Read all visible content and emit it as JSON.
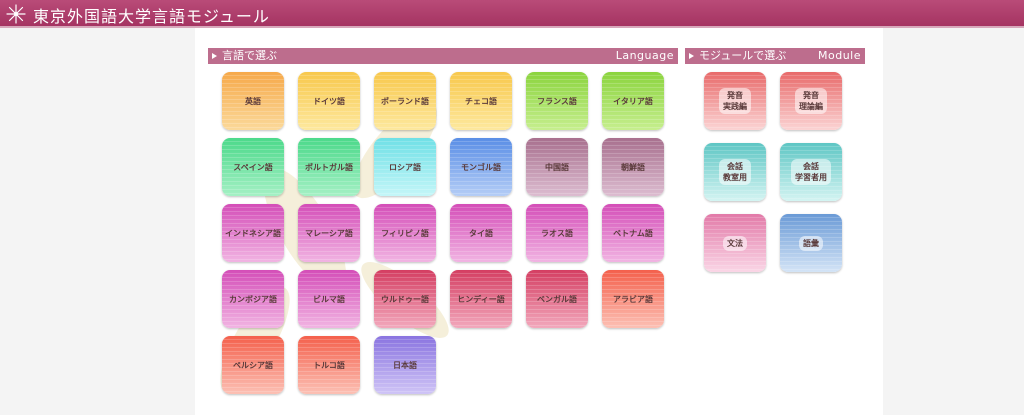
{
  "header": {
    "title": "東京外国語大学言語モジュール"
  },
  "language_section": {
    "label": "言語で選ぶ",
    "label_en": "Language"
  },
  "module_section": {
    "label": "モジュールで選ぶ",
    "label_en": "Module"
  },
  "languages": [
    {
      "label": "英語",
      "color": "orange"
    },
    {
      "label": "ドイツ語",
      "color": "yellow"
    },
    {
      "label": "ポーランド語",
      "color": "yellow"
    },
    {
      "label": "チェコ語",
      "color": "yellow"
    },
    {
      "label": "フランス語",
      "color": "lime"
    },
    {
      "label": "イタリア語",
      "color": "lime"
    },
    {
      "label": "スペイン語",
      "color": "green"
    },
    {
      "label": "ポルトガル語",
      "color": "green"
    },
    {
      "label": "ロシア語",
      "color": "cyan"
    },
    {
      "label": "モンゴル語",
      "color": "blue"
    },
    {
      "label": "中国語",
      "color": "mauve"
    },
    {
      "label": "朝鮮語",
      "color": "mauve"
    },
    {
      "label": "インドネシア語",
      "color": "magenta"
    },
    {
      "label": "マレーシア語",
      "color": "magenta"
    },
    {
      "label": "フィリピノ語",
      "color": "magenta"
    },
    {
      "label": "タイ語",
      "color": "magenta"
    },
    {
      "label": "ラオス語",
      "color": "magenta"
    },
    {
      "label": "ベトナム語",
      "color": "magenta"
    },
    {
      "label": "カンボジア語",
      "color": "magenta"
    },
    {
      "label": "ビルマ語",
      "color": "magenta"
    },
    {
      "label": "ウルドゥー語",
      "color": "crimson"
    },
    {
      "label": "ヒンディー語",
      "color": "crimson"
    },
    {
      "label": "ベンガル語",
      "color": "crimson"
    },
    {
      "label": "アラビア語",
      "color": "salmon"
    },
    {
      "label": "ペルシア語",
      "color": "salmon"
    },
    {
      "label": "トルコ語",
      "color": "salmon"
    },
    {
      "label": "日本語",
      "color": "violet"
    }
  ],
  "modules": [
    {
      "line1": "発音",
      "line2": "実践編",
      "color": "red"
    },
    {
      "line1": "発音",
      "line2": "理論編",
      "color": "red"
    },
    {
      "line1": "会話",
      "line2": "教室用",
      "color": "teal"
    },
    {
      "line1": "会話",
      "line2": "学習者用",
      "color": "teal"
    },
    {
      "line1": "文法",
      "line2": "",
      "color": "pink"
    },
    {
      "line1": "語彙",
      "line2": "",
      "color": "blue"
    }
  ]
}
